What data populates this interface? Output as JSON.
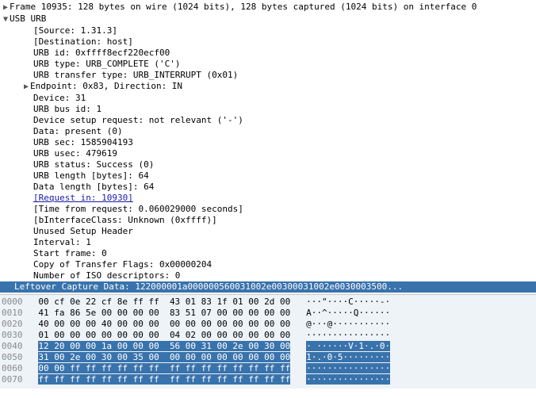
{
  "tree": {
    "frame_summary": "Frame 10935: 128 bytes on wire (1024 bits), 128 bytes captured (1024 bits) on interface 0",
    "usb_urb": "USB URB",
    "source": "[Source: 1.31.3]",
    "destination": "[Destination: host]",
    "urb_id": "URB id: 0xffff8ecf220ecf00",
    "urb_type": "URB type: URB_COMPLETE ('C')",
    "urb_transfer_type": "URB transfer type: URB_INTERRUPT (0x01)",
    "endpoint": "Endpoint: 0x83, Direction: IN",
    "device": "Device: 31",
    "urb_bus_id": "URB bus id: 1",
    "device_setup": "Device setup request: not relevant ('-')",
    "data_present": "Data: present (0)",
    "urb_sec": "URB sec: 1585904193",
    "urb_usec": "URB usec: 479619",
    "urb_status": "URB status: Success (0)",
    "urb_length": "URB length [bytes]: 64",
    "data_length": "Data length [bytes]: 64",
    "request_in": "[Request in: 10930]",
    "time_from_request": "[Time from request: 0.060029000 seconds]",
    "binterface_class": "[bInterfaceClass: Unknown (0xffff)]",
    "unused_setup": "Unused Setup Header",
    "interval": "Interval: 1",
    "start_frame": "Start frame: 0",
    "copy_flags": "Copy of Transfer Flags: 0x00000204",
    "num_iso": "Number of ISO descriptors: 0",
    "leftover": "Leftover Capture Data: 122000001a000000560031002e00300031002e0030003500..."
  },
  "hex": {
    "rows": [
      {
        "offset": "0000",
        "b1": "00 cf 0e 22 cf 8e ff ff",
        "b2": "43 01 83 1f 01 00 2d 00",
        "a1": "···\"····",
        "a2": "C·····-·",
        "hl": false
      },
      {
        "offset": "0010",
        "b1": "41 fa 86 5e 00 00 00 00",
        "b2": "83 51 07 00 00 00 00 00",
        "a1": "A··^····",
        "a2": "·Q······",
        "hl": false
      },
      {
        "offset": "0020",
        "b1": "40 00 00 00 40 00 00 00",
        "b2": "00 00 00 00 00 00 00 00",
        "a1": "@···@···",
        "a2": "········",
        "hl": false
      },
      {
        "offset": "0030",
        "b1": "01 00 00 00 00 00 00 00",
        "b2": "04 02 00 00 00 00 00 00",
        "a1": "········",
        "a2": "········",
        "hl": false
      },
      {
        "offset": "0040",
        "b1": "12 20 00 00 1a 00 00 00",
        "b2": "56 00 31 00 2e 00 30 00",
        "a1": "· ······",
        "a2": "V·1·.·0·",
        "hl": true
      },
      {
        "offset": "0050",
        "b1": "31 00 2e 00 30 00 35 00",
        "b2": "00 00 00 00 00 00 00 00",
        "a1": "1·.·0·5·",
        "a2": "········",
        "hl": true
      },
      {
        "offset": "0060",
        "b1": "00 00 ff ff ff ff ff ff",
        "b2": "ff ff ff ff ff ff ff ff",
        "a1": "········",
        "a2": "········",
        "hl": true
      },
      {
        "offset": "0070",
        "b1": "ff ff ff ff ff ff ff ff",
        "b2": "ff ff ff ff ff ff ff ff",
        "a1": "········",
        "a2": "········",
        "hl": true
      }
    ]
  }
}
